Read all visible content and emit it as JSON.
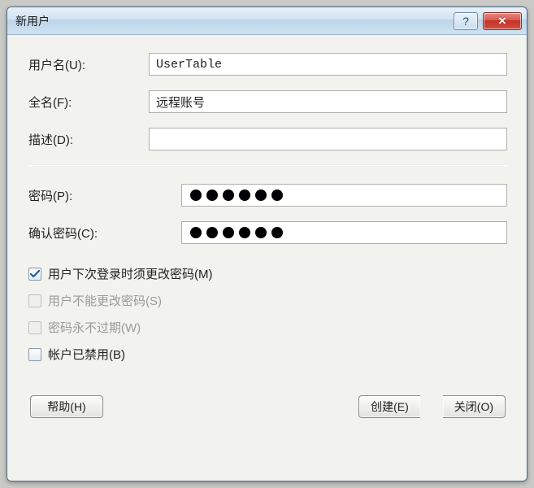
{
  "window": {
    "title": "新用户"
  },
  "fields": {
    "username_label": "用户名(U):",
    "username_value": "UserTable",
    "fullname_label": "全名(F):",
    "fullname_value": "远程账号",
    "description_label": "描述(D):",
    "description_value": "",
    "password_label": "密码(P):",
    "password_value": "••••••",
    "confirm_label": "确认密码(C):",
    "confirm_value": "••••••"
  },
  "checks": {
    "must_change": {
      "label": "用户下次登录时须更改密码(M)",
      "checked": true,
      "enabled": true
    },
    "cannot_change": {
      "label": "用户不能更改密码(S)",
      "checked": false,
      "enabled": false
    },
    "never_expires": {
      "label": "密码永不过期(W)",
      "checked": false,
      "enabled": false
    },
    "disabled_acct": {
      "label": "帐户已禁用(B)",
      "checked": false,
      "enabled": true
    }
  },
  "buttons": {
    "help": "帮助(H)",
    "create": "创建(E)",
    "close": "关闭(O)"
  }
}
